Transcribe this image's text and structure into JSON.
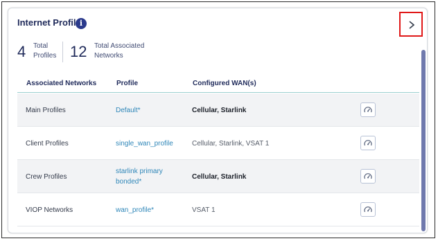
{
  "card": {
    "title": "Internet Profiles",
    "info_icon": "info-icon",
    "nav_icon": "chevron-right-icon"
  },
  "stats": [
    {
      "value": "4",
      "label": "Total Profiles",
      "label_line1": "Total",
      "label_line2": "Profiles"
    },
    {
      "value": "12",
      "label": "Total Associated Networks",
      "label_line1": "Total Associated",
      "label_line2": "Networks"
    }
  ],
  "table": {
    "columns": [
      "Associated Networks",
      "Profile",
      "Configured WAN(s)"
    ],
    "rows": [
      {
        "network": "Main Profiles",
        "profile": "Default*",
        "profile_line1": "Default*",
        "profile_line2": "",
        "wans": "Cellular, Starlink",
        "wans_bold": true,
        "action_icon": "speedometer-icon"
      },
      {
        "network": "Client Profiles",
        "profile": "single_wan_profile",
        "profile_line1": "single_wan_profile",
        "profile_line2": "",
        "wans": "Cellular, Starlink, VSAT 1",
        "wans_bold": false,
        "action_icon": "speedometer-icon"
      },
      {
        "network": "Crew Profiles",
        "profile": "starlink primary bonded*",
        "profile_line1": "starlink primary",
        "profile_line2": "bonded*",
        "wans": "Cellular, Starlink",
        "wans_bold": true,
        "action_icon": "speedometer-icon"
      },
      {
        "network": "VIOP Networks",
        "profile": "wan_profile*",
        "profile_line1": "wan_profile*",
        "profile_line2": "",
        "wans": "VSAT 1",
        "wans_bold": false,
        "action_icon": "speedometer-icon"
      }
    ]
  },
  "colors": {
    "title": "#1f2a5a",
    "link": "#2e86b8",
    "highlight_box": "#e01818",
    "header_rule": "#9bd0cf",
    "scrollbar": "#6f79ad"
  }
}
